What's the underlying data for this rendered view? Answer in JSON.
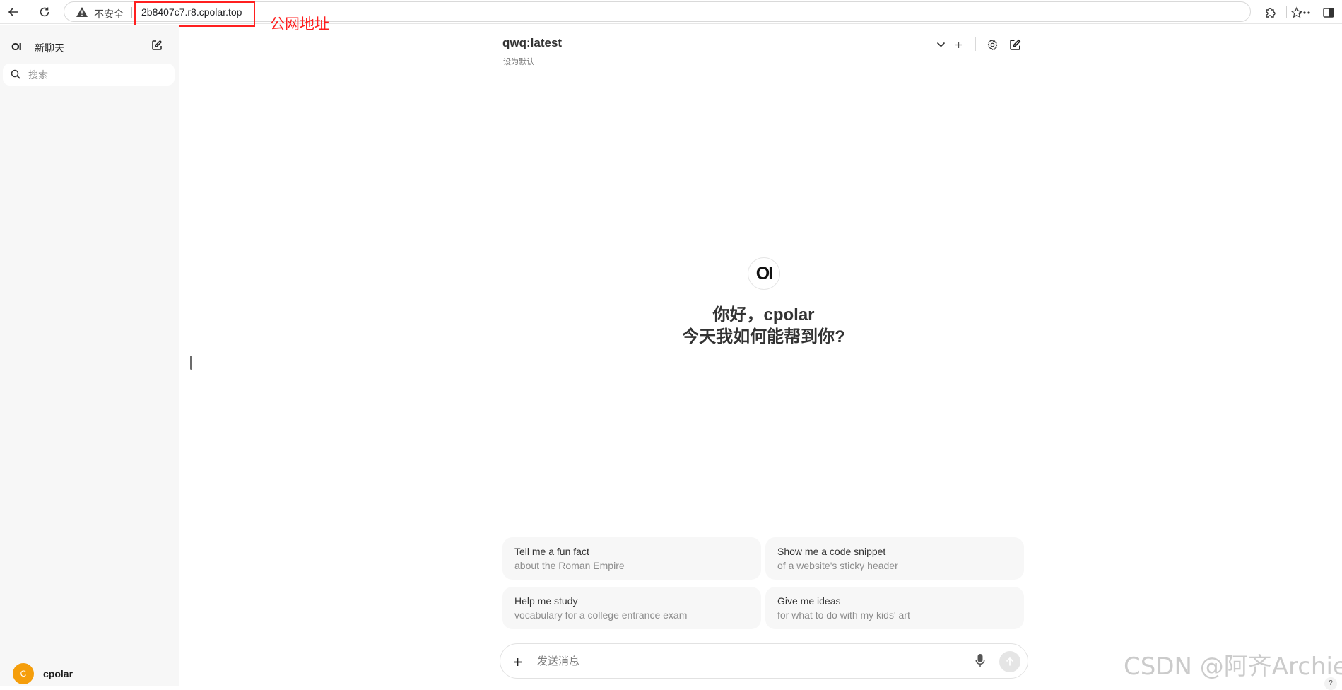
{
  "browser": {
    "security_label": "不安全",
    "url": "2b8407c7.r8.cpolar.top",
    "annotation": "公网地址"
  },
  "sidebar": {
    "logo": "OI",
    "new_chat_label": "新聊天",
    "search_placeholder": "搜索",
    "user": {
      "initial": "C",
      "name": "cpolar"
    }
  },
  "header": {
    "model_name": "qwq:latest",
    "set_default": "设为默认"
  },
  "welcome": {
    "logo": "OI",
    "line1": "你好，cpolar",
    "line2": "今天我如何能帮到你?"
  },
  "suggestions": [
    {
      "title": "Tell me a fun fact",
      "subtitle": "about the Roman Empire"
    },
    {
      "title": "Show me a code snippet",
      "subtitle": "of a website's sticky header"
    },
    {
      "title": "Help me study",
      "subtitle": "vocabulary for a college entrance exam"
    },
    {
      "title": "Give me ideas",
      "subtitle": "for what to do with my kids' art"
    }
  ],
  "composer": {
    "placeholder": "发送消息"
  },
  "watermark": "CSDN @阿齐Archie",
  "help_label": "?"
}
